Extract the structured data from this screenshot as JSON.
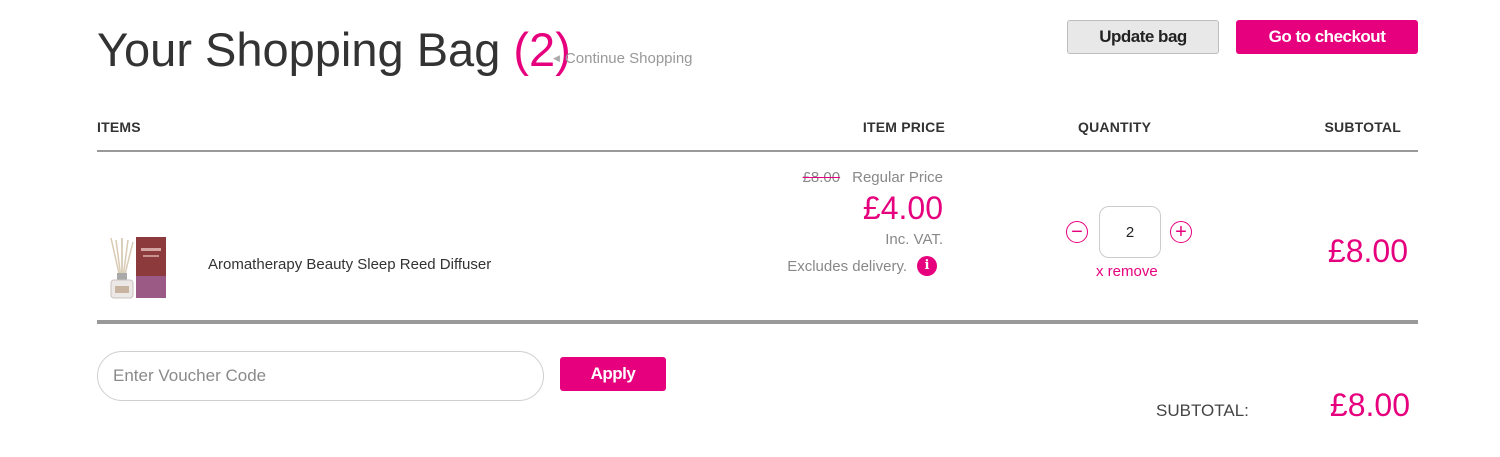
{
  "header": {
    "title": "Your Shopping Bag",
    "count": "(2)",
    "continue_label": "Continue Shopping",
    "update_label": "Update bag",
    "checkout_label": "Go to checkout"
  },
  "columns": {
    "items": "ITEMS",
    "item_price": "ITEM PRICE",
    "quantity": "QUANTITY",
    "subtotal": "SUBTOTAL"
  },
  "item": {
    "name": "Aromatherapy Beauty Sleep Reed Diffuser",
    "old_price": "£8.00",
    "regular_label": "Regular Price",
    "price": "£4.00",
    "inc_vat": "Inc. VAT.",
    "excludes": "Excludes delivery.",
    "info_icon": "i",
    "quantity": "2",
    "remove_label": "x remove",
    "subtotal": "£8.00"
  },
  "voucher": {
    "placeholder": "Enter Voucher Code",
    "apply_label": "Apply"
  },
  "totals": {
    "label": "SUBTOTAL:",
    "value": "£8.00"
  },
  "icons": {
    "continue": "caret-left-icon",
    "decrease": "minus-circle-icon",
    "increase": "plus-circle-icon",
    "info": "info-icon"
  },
  "colors": {
    "accent": "#e6007e",
    "text": "#333333",
    "muted": "#888888"
  }
}
